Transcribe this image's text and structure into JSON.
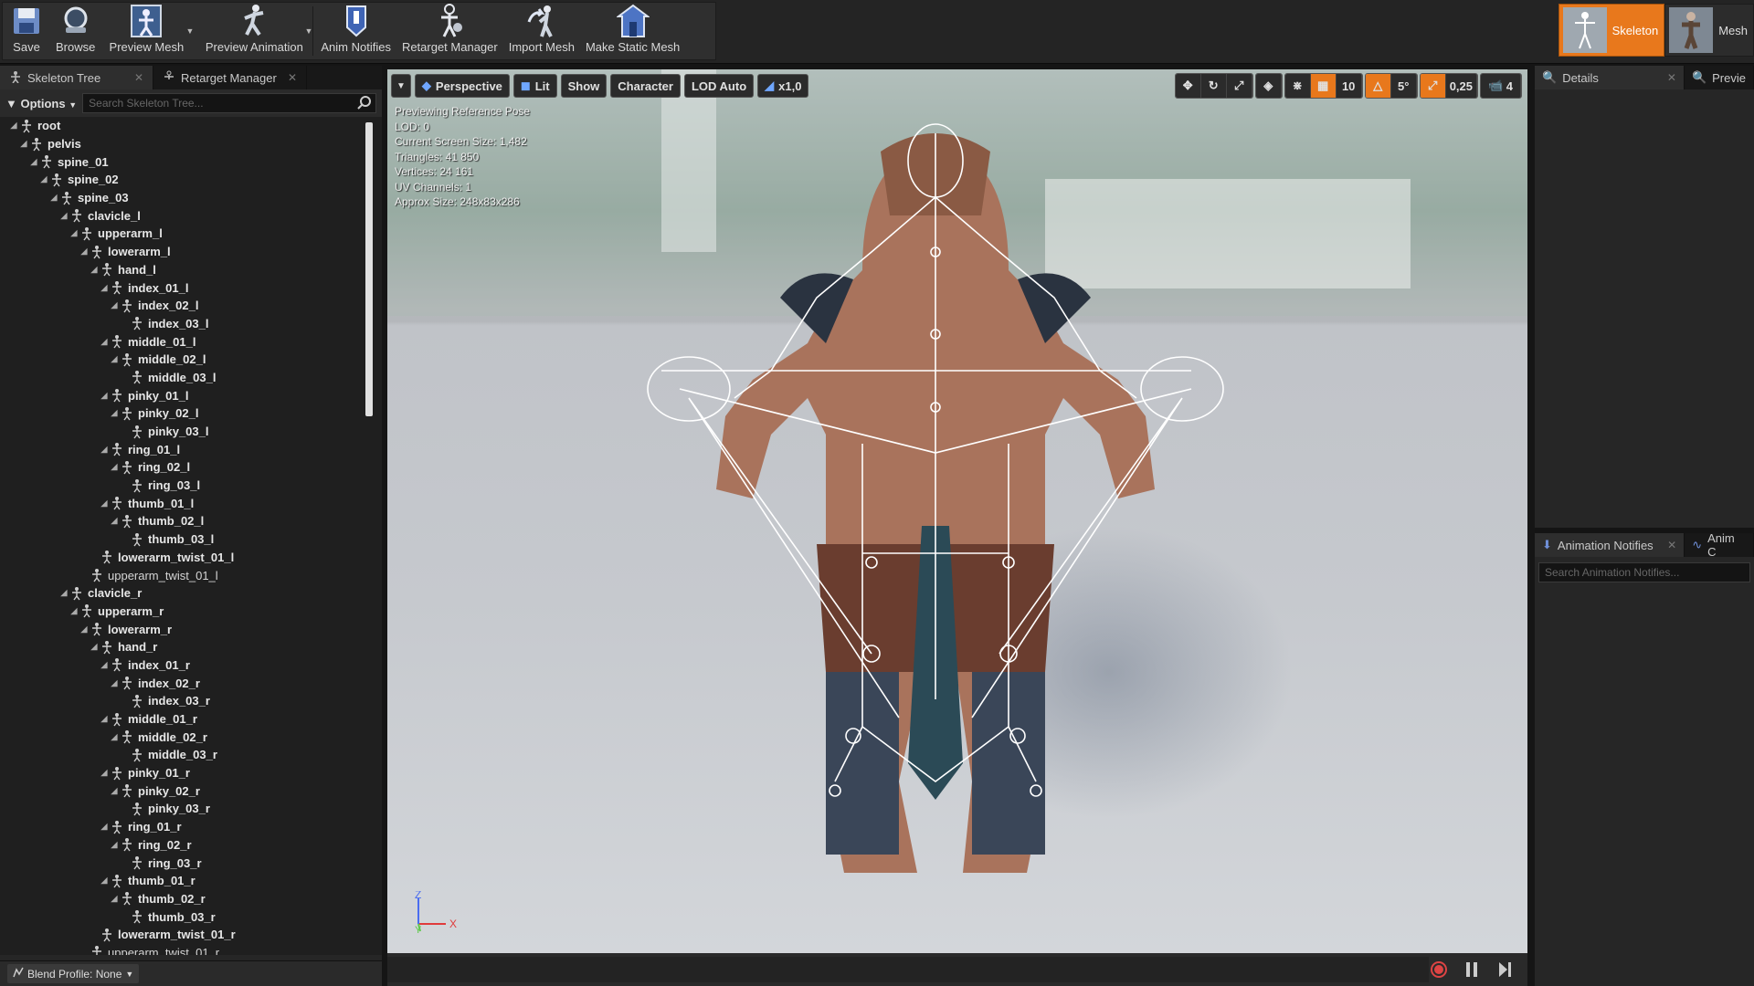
{
  "toolbar": {
    "save": "Save",
    "browse": "Browse",
    "preview_mesh": "Preview Mesh",
    "preview_animation": "Preview Animation",
    "anim_notifies": "Anim Notifies",
    "retarget_manager": "Retarget Manager",
    "import_mesh": "Import Mesh",
    "make_static_mesh": "Make Static Mesh"
  },
  "modes": {
    "skeleton": "Skeleton",
    "mesh": "Mesh"
  },
  "left_tabs": {
    "skeleton_tree": "Skeleton Tree",
    "retarget_manager": "Retarget Manager"
  },
  "skeleton_tree": {
    "options_label": "Options",
    "search_placeholder": "Search Skeleton Tree...",
    "bones": [
      {
        "name": "root",
        "depth": 0,
        "expandable": true,
        "bold": true
      },
      {
        "name": "pelvis",
        "depth": 1,
        "expandable": true,
        "bold": true
      },
      {
        "name": "spine_01",
        "depth": 2,
        "expandable": true,
        "bold": true
      },
      {
        "name": "spine_02",
        "depth": 3,
        "expandable": true,
        "bold": true
      },
      {
        "name": "spine_03",
        "depth": 4,
        "expandable": true,
        "bold": true
      },
      {
        "name": "clavicle_l",
        "depth": 5,
        "expandable": true,
        "bold": true
      },
      {
        "name": "upperarm_l",
        "depth": 6,
        "expandable": true,
        "bold": true
      },
      {
        "name": "lowerarm_l",
        "depth": 7,
        "expandable": true,
        "bold": true
      },
      {
        "name": "hand_l",
        "depth": 8,
        "expandable": true,
        "bold": true
      },
      {
        "name": "index_01_l",
        "depth": 9,
        "expandable": true,
        "bold": true
      },
      {
        "name": "index_02_l",
        "depth": 10,
        "expandable": true,
        "bold": true
      },
      {
        "name": "index_03_l",
        "depth": 11,
        "expandable": false,
        "bold": true
      },
      {
        "name": "middle_01_l",
        "depth": 9,
        "expandable": true,
        "bold": true
      },
      {
        "name": "middle_02_l",
        "depth": 10,
        "expandable": true,
        "bold": true
      },
      {
        "name": "middle_03_l",
        "depth": 11,
        "expandable": false,
        "bold": true
      },
      {
        "name": "pinky_01_l",
        "depth": 9,
        "expandable": true,
        "bold": true
      },
      {
        "name": "pinky_02_l",
        "depth": 10,
        "expandable": true,
        "bold": true
      },
      {
        "name": "pinky_03_l",
        "depth": 11,
        "expandable": false,
        "bold": true
      },
      {
        "name": "ring_01_l",
        "depth": 9,
        "expandable": true,
        "bold": true
      },
      {
        "name": "ring_02_l",
        "depth": 10,
        "expandable": true,
        "bold": true
      },
      {
        "name": "ring_03_l",
        "depth": 11,
        "expandable": false,
        "bold": true
      },
      {
        "name": "thumb_01_l",
        "depth": 9,
        "expandable": true,
        "bold": true
      },
      {
        "name": "thumb_02_l",
        "depth": 10,
        "expandable": true,
        "bold": true
      },
      {
        "name": "thumb_03_l",
        "depth": 11,
        "expandable": false,
        "bold": true
      },
      {
        "name": "lowerarm_twist_01_l",
        "depth": 8,
        "expandable": false,
        "bold": true
      },
      {
        "name": "upperarm_twist_01_l",
        "depth": 7,
        "expandable": false,
        "bold": false
      },
      {
        "name": "clavicle_r",
        "depth": 5,
        "expandable": true,
        "bold": true
      },
      {
        "name": "upperarm_r",
        "depth": 6,
        "expandable": true,
        "bold": true
      },
      {
        "name": "lowerarm_r",
        "depth": 7,
        "expandable": true,
        "bold": true
      },
      {
        "name": "hand_r",
        "depth": 8,
        "expandable": true,
        "bold": true
      },
      {
        "name": "index_01_r",
        "depth": 9,
        "expandable": true,
        "bold": true
      },
      {
        "name": "index_02_r",
        "depth": 10,
        "expandable": true,
        "bold": true
      },
      {
        "name": "index_03_r",
        "depth": 11,
        "expandable": false,
        "bold": true
      },
      {
        "name": "middle_01_r",
        "depth": 9,
        "expandable": true,
        "bold": true
      },
      {
        "name": "middle_02_r",
        "depth": 10,
        "expandable": true,
        "bold": true
      },
      {
        "name": "middle_03_r",
        "depth": 11,
        "expandable": false,
        "bold": true
      },
      {
        "name": "pinky_01_r",
        "depth": 9,
        "expandable": true,
        "bold": true
      },
      {
        "name": "pinky_02_r",
        "depth": 10,
        "expandable": true,
        "bold": true
      },
      {
        "name": "pinky_03_r",
        "depth": 11,
        "expandable": false,
        "bold": true
      },
      {
        "name": "ring_01_r",
        "depth": 9,
        "expandable": true,
        "bold": true
      },
      {
        "name": "ring_02_r",
        "depth": 10,
        "expandable": true,
        "bold": true
      },
      {
        "name": "ring_03_r",
        "depth": 11,
        "expandable": false,
        "bold": true
      },
      {
        "name": "thumb_01_r",
        "depth": 9,
        "expandable": true,
        "bold": true
      },
      {
        "name": "thumb_02_r",
        "depth": 10,
        "expandable": true,
        "bold": true
      },
      {
        "name": "thumb_03_r",
        "depth": 11,
        "expandable": false,
        "bold": true
      },
      {
        "name": "lowerarm_twist_01_r",
        "depth": 8,
        "expandable": false,
        "bold": true
      },
      {
        "name": "upperarm_twist_01_r",
        "depth": 7,
        "expandable": false,
        "bold": false
      }
    ],
    "blend_profile": "Blend Profile: None"
  },
  "viewport": {
    "perspective": "Perspective",
    "lit": "Lit",
    "show": "Show",
    "character": "Character",
    "lod": "LOD Auto",
    "speed": "x1,0",
    "grid_snap": "10",
    "rotation_snap": "5°",
    "scale_snap": "0,25",
    "camera_speed": "4",
    "info": [
      "Previewing Reference Pose",
      "LOD: 0",
      "Current Screen Size: 1,482",
      "Triangles: 41 850",
      "Vertices: 24 161",
      "UV Channels: 1",
      "Approx Size: 248x83x286"
    ],
    "axis_x": "X",
    "axis_y": "Y",
    "axis_z": "Z"
  },
  "right": {
    "details_tab": "Details",
    "preview_tab": "Previe",
    "anim_notifies_tab": "Animation Notifies",
    "anim_curves_tab": "Anim C",
    "anim_search_placeholder": "Search Animation Notifies..."
  },
  "colors": {
    "accent": "#e8781c",
    "bone_white": "#ffffff",
    "axis_x": "#e03b3b",
    "axis_y": "#5ec84a",
    "axis_z": "#4a6cf0"
  }
}
